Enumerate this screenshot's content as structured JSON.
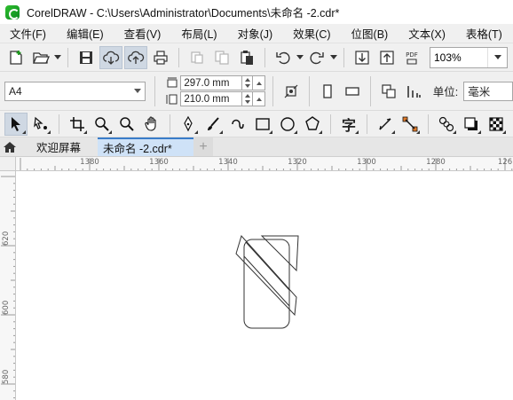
{
  "window": {
    "title": "CorelDRAW - C:\\Users\\Administrator\\Documents\\未命名 -2.cdr*"
  },
  "menu": [
    "文件(F)",
    "编辑(E)",
    "查看(V)",
    "布局(L)",
    "对象(J)",
    "效果(C)",
    "位图(B)",
    "文本(X)",
    "表格(T)"
  ],
  "toolbar": {
    "zoom_value": "103%",
    "pdf_label": "PDF"
  },
  "property_bar": {
    "paper_size": "A4",
    "width_value": "297.0 mm",
    "height_value": "210.0 mm",
    "unit_label": "单位:",
    "unit_value": "毫米"
  },
  "toolbox": {
    "text_tool_glyph": "字"
  },
  "tabs": {
    "welcome": "欢迎屏幕",
    "document": "未命名 -2.cdr*",
    "add": "+"
  },
  "ruler": {
    "h_labels": [
      "1380",
      "1360",
      "1340",
      "1320",
      "1300",
      "1280",
      "126"
    ],
    "v_labels": [
      "620",
      "600",
      "580"
    ]
  },
  "colors": {
    "accent": "#3a7cc9",
    "active_tab": "#cfe2f7",
    "toolbar_bg": "#f0f0f0"
  }
}
